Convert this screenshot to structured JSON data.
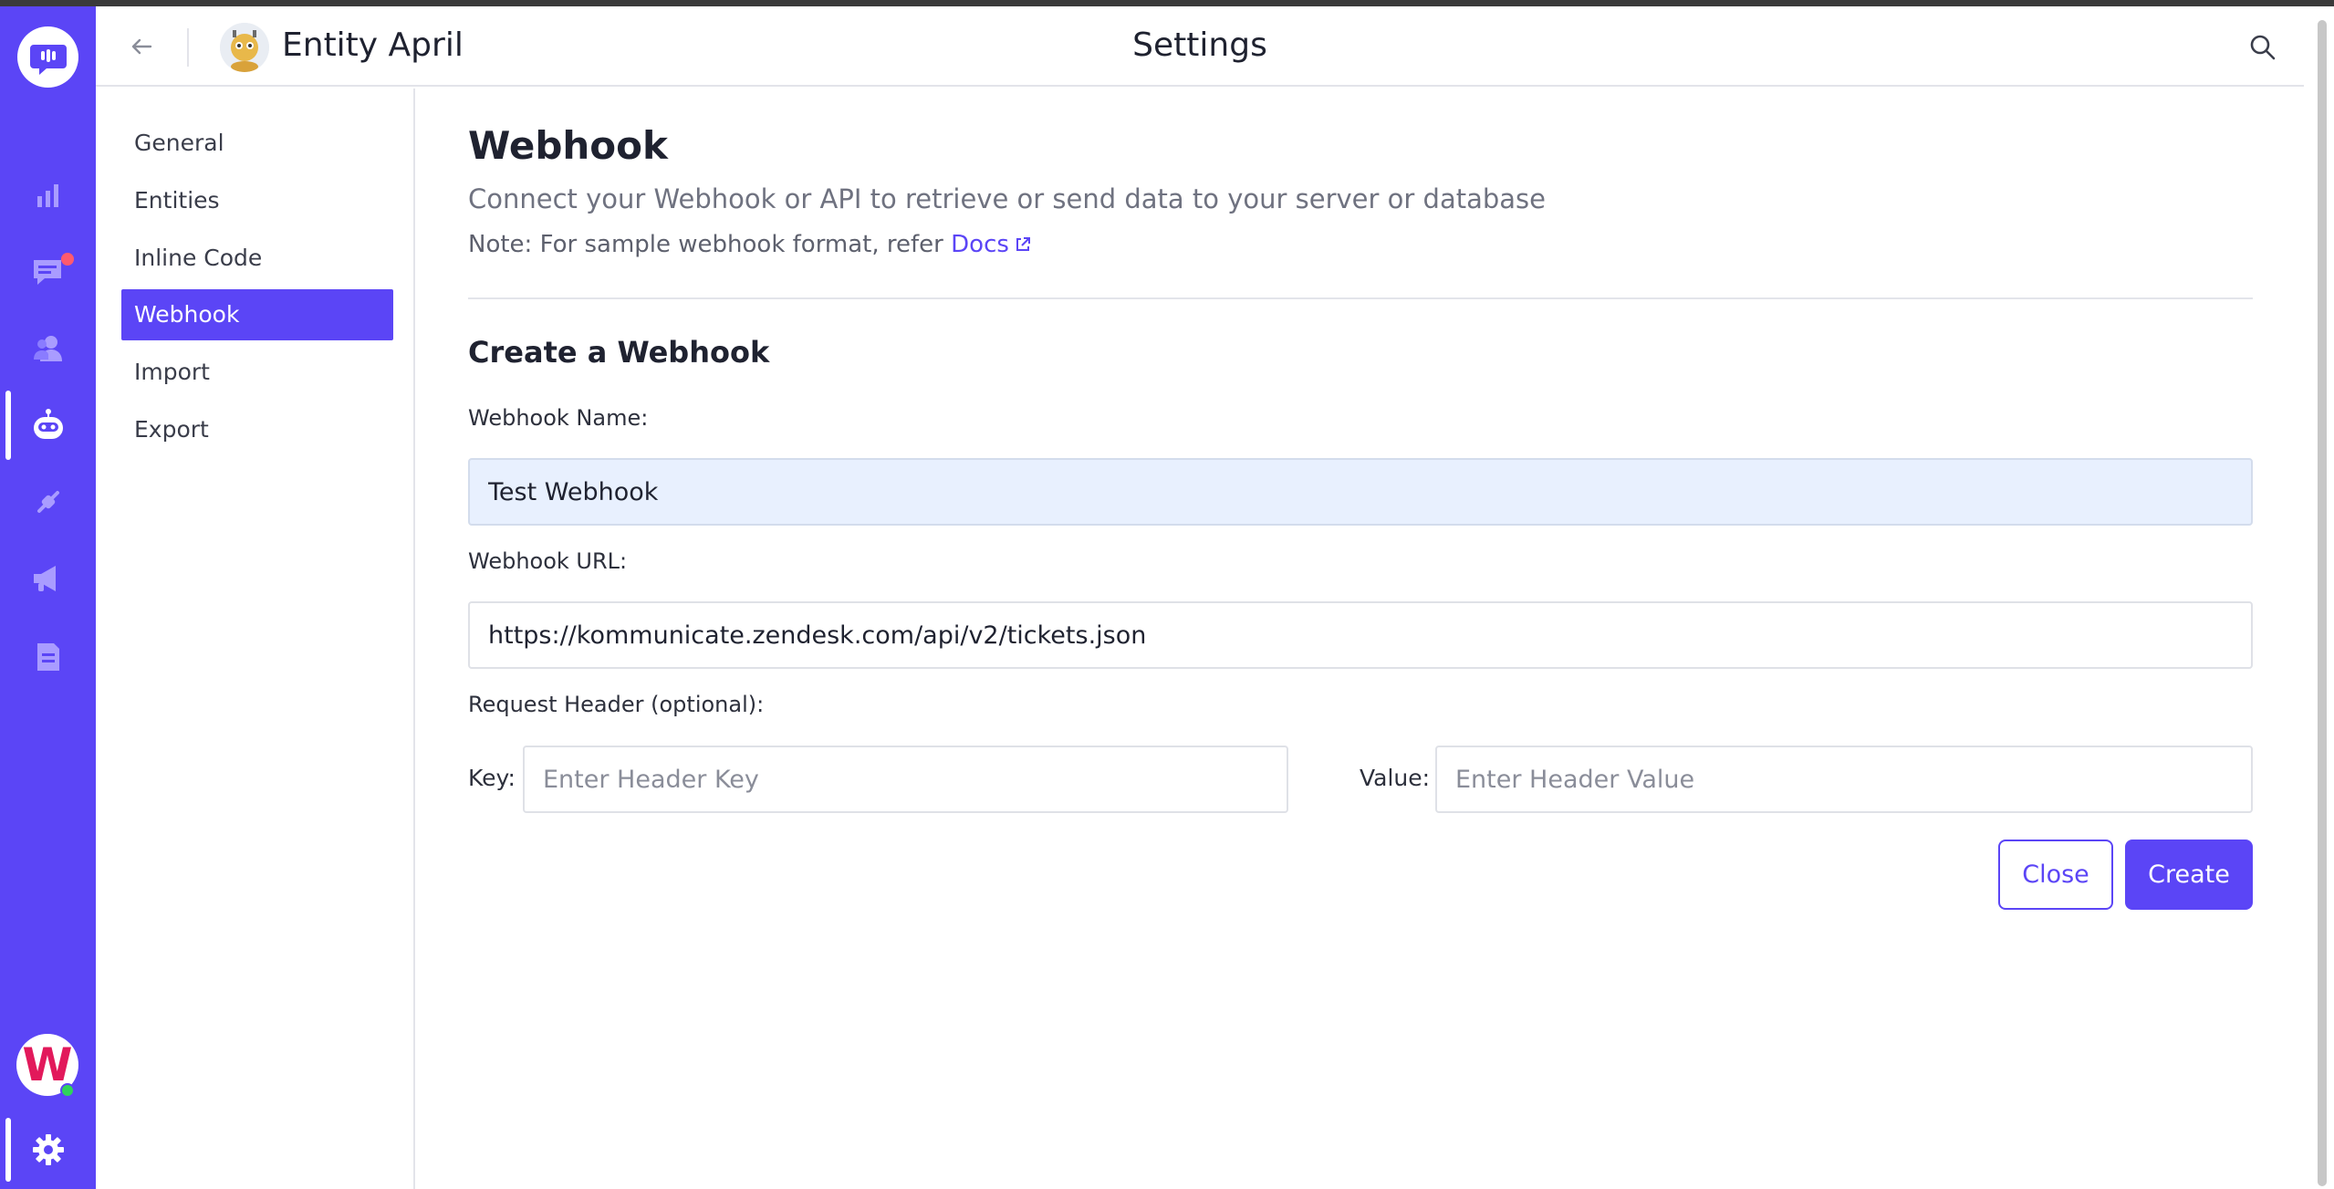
{
  "header": {
    "bot_name": "Entity April",
    "title": "Settings"
  },
  "subnav": {
    "items": [
      {
        "label": "General"
      },
      {
        "label": "Entities"
      },
      {
        "label": "Inline Code"
      },
      {
        "label": "Webhook",
        "active": true
      },
      {
        "label": "Import"
      },
      {
        "label": "Export"
      }
    ]
  },
  "main": {
    "title": "Webhook",
    "subtitle": "Connect your Webhook or API to retrieve or send data to your server or database",
    "note_prefix": "Note: For sample webhook format, refer",
    "note_link": "Docs",
    "section_title": "Create a Webhook",
    "name_label": "Webhook Name:",
    "name_value": "Test Webhook",
    "url_label": "Webhook URL:",
    "url_value": "https://kommunicate.zendesk.com/api/v2/tickets.json",
    "header_label": "Request Header (optional):",
    "key_label": "Key:",
    "key_placeholder": "Enter Header Key",
    "value_label": "Value:",
    "value_placeholder": "Enter Header Value",
    "close_label": "Close",
    "create_label": "Create"
  },
  "rail": {
    "avatar_letter": "W"
  },
  "colors": {
    "accent": "#5b45f6",
    "rail_bg": "#5b45f6",
    "input_filled_bg": "#e8f0fe",
    "badge": "#ff5a6e",
    "online": "#2fd35a"
  }
}
